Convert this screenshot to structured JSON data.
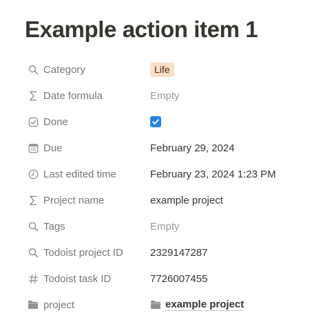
{
  "page": {
    "title": "Example action item 1"
  },
  "properties": [
    {
      "name": "Category",
      "icon": "search-icon",
      "value": "Life",
      "kind": "tag",
      "tag_color": "#fbdfc9"
    },
    {
      "name": "Date formula",
      "icon": "sigma-icon",
      "value": "Empty",
      "kind": "empty"
    },
    {
      "name": "Done",
      "icon": "checkbox-icon",
      "value": true,
      "kind": "checkbox",
      "accent": "#2383e2"
    },
    {
      "name": "Due",
      "icon": "calendar-icon",
      "value": "February 29, 2024",
      "kind": "text"
    },
    {
      "name": "Last edited time",
      "icon": "clock-icon",
      "value": "February 23, 2024 1:23 PM",
      "kind": "text"
    },
    {
      "name": "Project name",
      "icon": "sigma-icon",
      "value": "example project",
      "kind": "text"
    },
    {
      "name": "Tags",
      "icon": "search-icon",
      "value": "Empty",
      "kind": "empty"
    },
    {
      "name": "Todoist project ID",
      "icon": "search-icon",
      "value": "2329147287",
      "kind": "text"
    },
    {
      "name": "Todoist task ID",
      "icon": "hash-icon",
      "value": "7726007455",
      "kind": "text"
    },
    {
      "name": "project",
      "icon": "folder-icon",
      "value": "example project",
      "kind": "relation"
    }
  ]
}
